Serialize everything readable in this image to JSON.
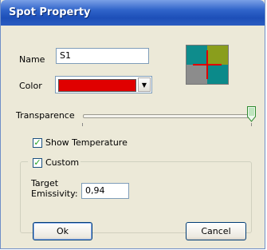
{
  "window": {
    "title": "Spot Property"
  },
  "name": {
    "label": "Name",
    "value": "S1"
  },
  "color": {
    "label": "Color",
    "value_hex": "#e00000"
  },
  "transparence": {
    "label": "Transparence",
    "level_percent": 100
  },
  "show_temperature": {
    "label": "Show Temperature",
    "checked": true
  },
  "custom": {
    "label": "Custom",
    "checked": true
  },
  "emissivity": {
    "label_line1": "Target",
    "label_line2": "Emissivity:",
    "value": "0,94"
  },
  "buttons": {
    "ok": "Ok",
    "cancel": "Cancel"
  },
  "preview_colors": {
    "q1": "#0e8c8c",
    "q2": "#8a9e1c",
    "q3": "#8c8c8c",
    "q4": "#0b8a8a",
    "cross": "#e00000"
  }
}
